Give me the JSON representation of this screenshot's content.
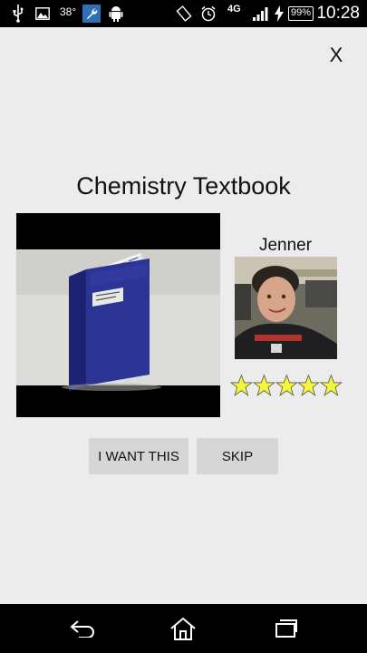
{
  "status_bar": {
    "temperature": "38°",
    "network": "4G",
    "battery": "99%",
    "time": "10:28",
    "icons": [
      "usb-icon",
      "image-icon",
      "wrench-icon",
      "android-icon",
      "rotate-icon",
      "alarm-icon",
      "signal-icon",
      "charging-icon"
    ]
  },
  "dialog": {
    "close_label": "X",
    "item_title": "Chemistry Textbook",
    "seller_name": "Jenner",
    "rating": 5,
    "rating_color": "#f2f73a",
    "want_label": "I WANT THIS",
    "skip_label": "SKIP"
  },
  "nav_bar": {
    "icons": [
      "back-icon",
      "home-icon",
      "recents-icon"
    ]
  }
}
